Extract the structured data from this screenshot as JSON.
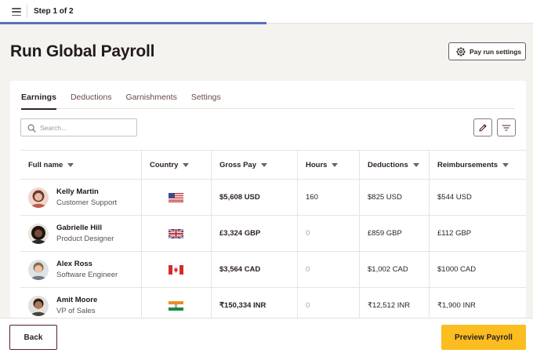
{
  "header": {
    "step_label": "Step 1 of 2",
    "progress_fraction": 0.5,
    "progress_color": "#5572b8"
  },
  "page": {
    "title": "Run Global Payroll",
    "settings_button": {
      "label": "Pay run settings",
      "icon": "gear-icon"
    }
  },
  "tabs": [
    {
      "label": "Earnings",
      "active": true
    },
    {
      "label": "Deductions",
      "active": false
    },
    {
      "label": "Garnishments",
      "active": false
    },
    {
      "label": "Settings",
      "active": false
    }
  ],
  "toolbar": {
    "search_placeholder": "Search...",
    "search_value": "",
    "edit_icon": "pencil-icon",
    "filter_icon": "filter-icon"
  },
  "table": {
    "columns": [
      "Full name",
      "Country",
      "Gross Pay",
      "Hours",
      "Deductions",
      "Reimbursements"
    ],
    "rows": [
      {
        "name": "Kelly Martin",
        "role": "Customer Support",
        "country_flag": "us-flag-icon",
        "gross_pay": "$5,608 USD",
        "hours": "160",
        "deductions": "$825 USD",
        "reimbursements": "$544 USD"
      },
      {
        "name": "Gabrielle Hill",
        "role": "Product Designer",
        "country_flag": "uk-flag-icon",
        "gross_pay": "£3,324 GBP",
        "hours": "0",
        "deductions": "£859 GBP",
        "reimbursements": "£112 GBP"
      },
      {
        "name": "Alex Ross",
        "role": "Software Engineer",
        "country_flag": "canada-flag-icon",
        "gross_pay": "$3,564 CAD",
        "hours": "0",
        "deductions": "$1,002 CAD",
        "reimbursements": "$1000 CAD"
      },
      {
        "name": "Amit Moore",
        "role": "VP of Sales",
        "country_flag": "india-flag-icon",
        "gross_pay": "₹150,334 INR",
        "hours": "0",
        "deductions": "₹12,512 INR",
        "reimbursements": "₹1,900 INR"
      }
    ]
  },
  "footer": {
    "back_label": "Back",
    "preview_label": "Preview Payroll",
    "accent_color": "#fbbd1f"
  }
}
